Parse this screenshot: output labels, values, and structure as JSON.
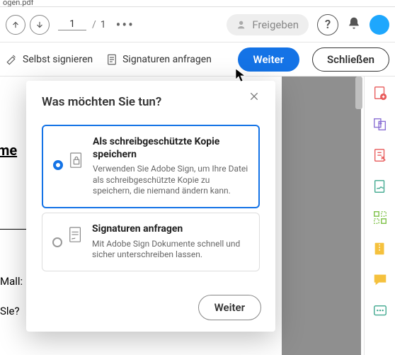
{
  "tab_remnant": "ogen.pdf",
  "toolbar": {
    "page_current": "1",
    "page_sep": "/",
    "page_total": "1",
    "share_label": "Freigeben",
    "help_label": "?"
  },
  "actionbar": {
    "self_sign": "Selbst signieren",
    "request_sign": "Signaturen anfragen",
    "next": "Weiter",
    "close": "Schließen"
  },
  "doc_fragments": {
    "me": "me",
    "mail": "Mall:",
    "sie": "Sle?"
  },
  "modal": {
    "title": "Was möchten Sie tun?",
    "option1_title": "Als schreibgeschützte Kopie speichern",
    "option1_desc": "Verwenden Sie Adobe Sign, um Ihre Datei als schreibgeschützte Kopie zu speichern, die niemand ändern kann.",
    "option2_title": "Signaturen anfragen",
    "option2_desc": "Mit Adobe Sign Dokumente schnell und sicher unterschreiben lassen.",
    "continue": "Weiter"
  },
  "side_tools": [
    "create-pdf",
    "export-pdf",
    "edit-pdf",
    "sign",
    "organize",
    "compress",
    "comment",
    "more"
  ]
}
